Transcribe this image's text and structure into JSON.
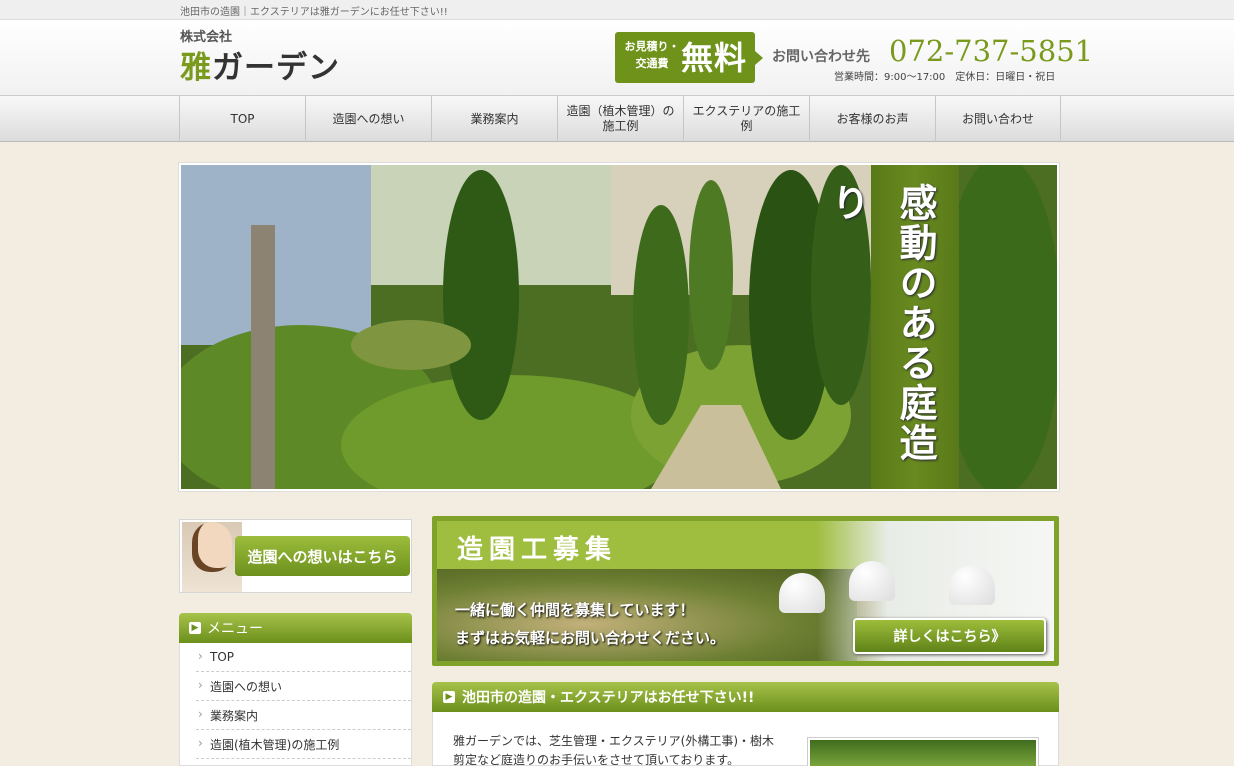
{
  "topbar": {
    "text": "池田市の造園｜エクステリアは雅ガーデンにお任せ下さい!!"
  },
  "header": {
    "logo_small": "株式会社",
    "logo_main_accent": "雅",
    "logo_main_rest": "ガーデン",
    "quote_line1": "お見積り・",
    "quote_line2": "交通費",
    "quote_free": "無料",
    "contact_label": "お問い合わせ先",
    "phone": "072-737-5851",
    "hours": "営業時間：9:00〜17:00　定休日：日曜日・祝日"
  },
  "nav": {
    "items": [
      {
        "label": "TOP"
      },
      {
        "label": "造園への想い"
      },
      {
        "label": "業務案内"
      },
      {
        "label": "造園（植木管理）の施工例"
      },
      {
        "label": "エクステリアの施工例"
      },
      {
        "label": "お客様のお声"
      },
      {
        "label": "お問い合わせ"
      }
    ]
  },
  "hero": {
    "catch": "感動のある庭造り"
  },
  "side_banner": {
    "label": "造園への想いはこちら"
  },
  "menu": {
    "title": "メニュー",
    "items": [
      {
        "label": "TOP"
      },
      {
        "label": "造園への想い"
      },
      {
        "label": "業務案内"
      },
      {
        "label": "造園(植木管理)の施工例"
      }
    ]
  },
  "recruit": {
    "title": "造園工募集",
    "line1": "一緒に働く仲間を募集しています！",
    "line2": "まずはお気軽にお問い合わせください。",
    "button": "詳しくはこちら》"
  },
  "content": {
    "heading": "池田市の造園・エクステリアはお任せ下さい!!",
    "body": "雅ガーデンでは、芝生管理・エクステリア(外構工事)・樹木剪定など庭造りのお手伝いをさせて頂いております。"
  },
  "colors": {
    "accent": "#7a9a1e",
    "nav_bg": "#e6e6e6",
    "page_bg": "#f2ede0"
  }
}
